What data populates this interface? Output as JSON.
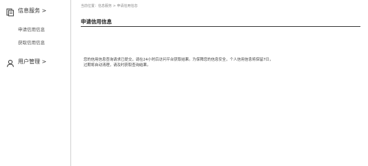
{
  "sidebar": {
    "groups": [
      {
        "title": "信息服务 >",
        "icon": "document-icon",
        "items": [
          "申请信用信息",
          "获取信用信息"
        ]
      },
      {
        "title": "用户管理 >",
        "icon": "user-icon",
        "items": []
      }
    ]
  },
  "main": {
    "breadcrumb": "当前位置：信息服务 > 申请信用信息",
    "title": "申请信用信息",
    "message_line1": "您的信用信息查询请求已提交，请在24小时后访问平台获取结果。为保障您的信息安全，个人信用信息将保留7日，",
    "message_line2": "过期将自动清理，请及时获取查询结果。"
  }
}
